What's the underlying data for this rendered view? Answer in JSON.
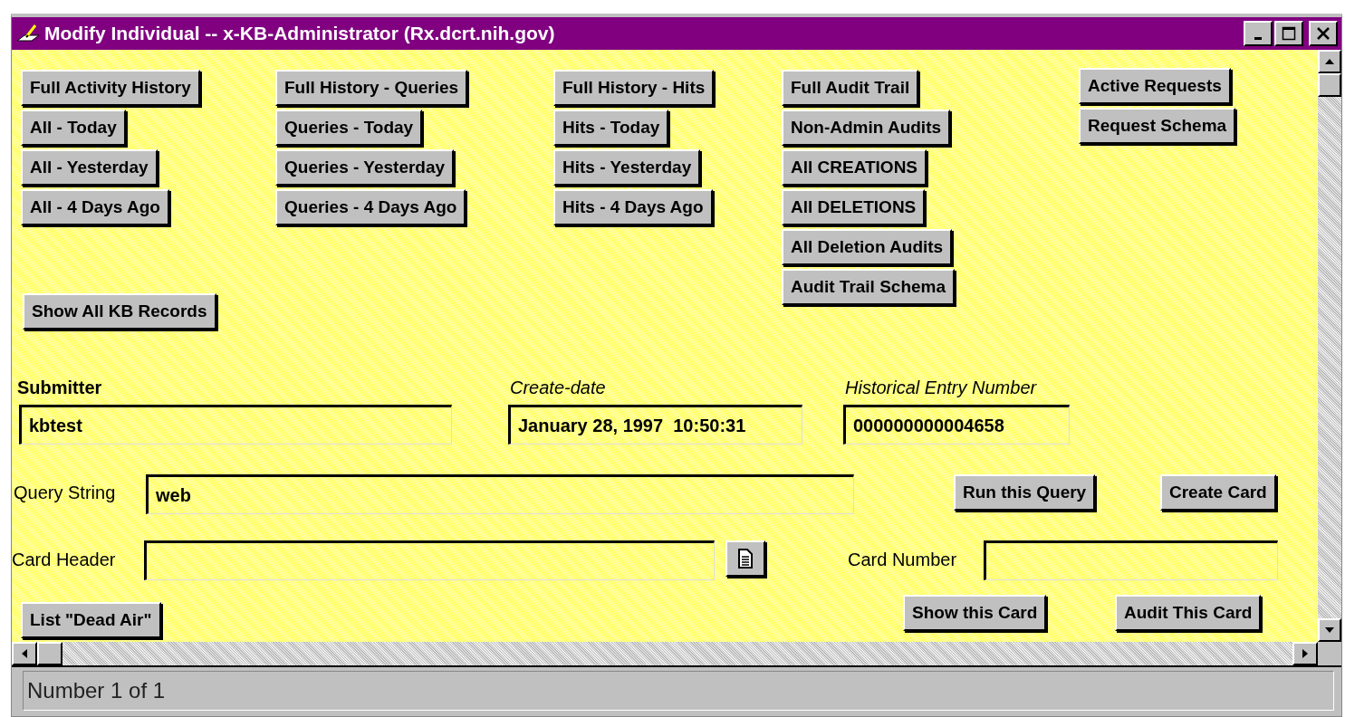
{
  "window": {
    "title": "Modify Individual -- x-KB-Administrator (Rx.dcrt.nih.gov)"
  },
  "button_columns": [
    [
      "Full Activity History",
      "All - Today",
      "All - Yesterday",
      "All - 4 Days Ago"
    ],
    [
      "Full History - Queries",
      "Queries - Today",
      "Queries - Yesterday",
      "Queries - 4 Days Ago"
    ],
    [
      "Full History - Hits",
      "Hits - Today",
      "Hits - Yesterday",
      "Hits - 4 Days Ago"
    ],
    [
      "Full Audit Trail",
      "Non-Admin Audits",
      "All CREATIONS",
      "All DELETIONS",
      "All Deletion Audits",
      "Audit Trail Schema"
    ],
    [
      "Active Requests",
      "Request Schema"
    ]
  ],
  "show_all_button": "Show All KB Records",
  "fields": [
    {
      "kind": "bold",
      "label": "Submitter",
      "value": "kbtest"
    },
    {
      "kind": "italic",
      "label": "Create-date",
      "value": "January 28, 1997  10:50:31"
    },
    {
      "kind": "italic",
      "label": "Historical Entry Number",
      "value": "000000000004658"
    },
    {
      "kind": "plain",
      "label": "Query String",
      "value": "web"
    },
    {
      "kind": "plain",
      "label": "Card Header"
    },
    {
      "kind": "plain",
      "label": "Card Number"
    }
  ],
  "action_buttons": [
    "Run this Query",
    "Create Card",
    "Show this Card",
    "Audit This Card",
    "List \"Dead Air\""
  ],
  "status_bar": "Number 1 of 1"
}
